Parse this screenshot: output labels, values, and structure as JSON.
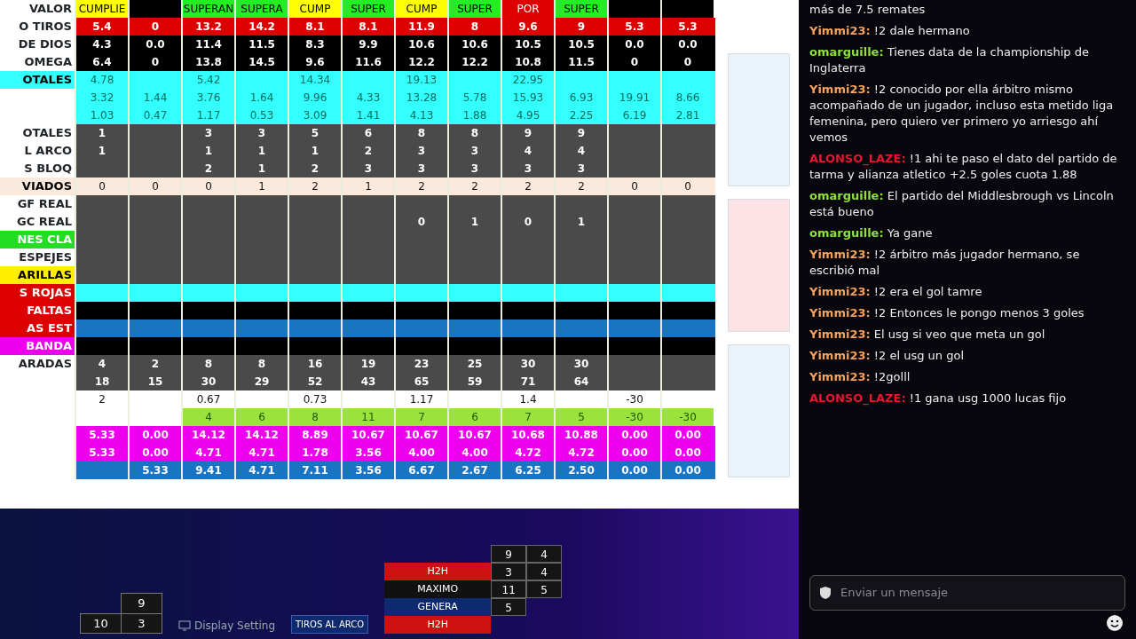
{
  "sheet": {
    "rows": [
      {
        "label": "VALOR",
        "kind": "header",
        "cells": [
          {
            "text": "CUMPLIE",
            "color": "#ffff00"
          },
          {
            "color": "#000000"
          },
          {
            "text": "SUPERAN",
            "color": "#22ee22"
          },
          {
            "text": "SUPERA",
            "color": "#22ee22"
          },
          {
            "text": "CUMP",
            "color": "#ffff00"
          },
          {
            "text": "SUPER",
            "color": "#22ee22"
          },
          {
            "text": "CUMP",
            "color": "#ffff00"
          },
          {
            "text": "SUPER",
            "color": "#22ee22"
          },
          {
            "text": "POR",
            "color": "#dd0000"
          },
          {
            "text": "SUPER",
            "color": "#22ee22"
          },
          {
            "color": "#000000"
          },
          {
            "color": "#000000"
          }
        ]
      },
      {
        "label": "O TIROS",
        "kind": "red",
        "cells": [
          "5.4",
          "0",
          "13.2",
          "14.2",
          "8.1",
          "8.1",
          "11.9",
          "8",
          "9.6",
          "9",
          "5.3",
          "5.3"
        ]
      },
      {
        "label": "DE DIOS",
        "kind": "black",
        "cells": [
          "4.3",
          "0.0",
          "11.4",
          "11.5",
          "8.3",
          "9.9",
          "10.6",
          "10.6",
          "10.5",
          "10.5",
          "0.0",
          "0.0"
        ]
      },
      {
        "label": "OMEGA",
        "kind": "black",
        "cells": [
          "6.4",
          "0",
          "13.8",
          "14.5",
          "9.6",
          "11.6",
          "12.2",
          "12.2",
          "10.8",
          "11.5",
          "0",
          "0"
        ]
      },
      {
        "label": "OTALES",
        "color": "#33ffff",
        "kind": "cyan",
        "cells": [
          "4.78",
          null,
          "5.42",
          null,
          "14.34",
          null,
          "19.13",
          null,
          "22.95",
          null,
          null,
          null
        ]
      },
      {
        "kind": "cyan",
        "cells": [
          "3.32",
          "1.44",
          "3.76",
          "1.64",
          "9.96",
          "4.33",
          "13.28",
          "5.78",
          "15.93",
          "6.93",
          "19.91",
          "8.66"
        ]
      },
      {
        "kind": "cyan",
        "cells": [
          "1.03",
          "0.47",
          "1.17",
          "0.53",
          "3.09",
          "1.41",
          "4.13",
          "1.88",
          "4.95",
          "2.25",
          "6.19",
          "2.81"
        ]
      },
      {
        "label": "OTALES",
        "kind": "gray",
        "cells": [
          "1",
          null,
          "3",
          "3",
          "5",
          "6",
          "8",
          "8",
          "9",
          "9",
          null,
          null
        ]
      },
      {
        "label": "L ARCO",
        "kind": "gray",
        "cells": [
          "1",
          null,
          "1",
          "1",
          "1",
          "2",
          "3",
          "3",
          "4",
          "4",
          null,
          null
        ]
      },
      {
        "label": "S BLOQ",
        "kind": "gray",
        "cells": [
          null,
          null,
          "2",
          "1",
          "2",
          "3",
          "3",
          "3",
          "3",
          "3",
          null,
          null
        ]
      },
      {
        "label": "VIADOS",
        "color": "#fbe9dc",
        "kind": "beige",
        "cells": [
          "0",
          "0",
          "0",
          "1",
          "2",
          "1",
          "2",
          "2",
          "2",
          "2",
          "0",
          "0"
        ]
      },
      {
        "label": "GF REAL",
        "kind": "gray",
        "cells": [
          null,
          null,
          null,
          null,
          null,
          null,
          null,
          null,
          null,
          null,
          null,
          null
        ]
      },
      {
        "label": "GC REAL",
        "kind": "gray",
        "cells": [
          null,
          null,
          null,
          null,
          null,
          null,
          "0",
          "1",
          "0",
          "1",
          null,
          null
        ]
      },
      {
        "label": "NES CLA",
        "color": "#22dd22",
        "kind": "gray",
        "cells": [
          null,
          null,
          null,
          null,
          null,
          null,
          null,
          null,
          null,
          null,
          null,
          null
        ]
      },
      {
        "label": "ESPEJES",
        "kind": "gray",
        "cells": [
          null,
          null,
          null,
          null,
          null,
          null,
          null,
          null,
          null,
          null,
          null,
          null
        ]
      },
      {
        "label": "ARILLAS",
        "color": "#ffee00",
        "kind": "gray",
        "cells": [
          null,
          null,
          null,
          null,
          null,
          null,
          null,
          null,
          null,
          null,
          null,
          null
        ]
      },
      {
        "label": "S ROJAS",
        "color": "#dd0000",
        "kind": "cyan",
        "cells": [
          null,
          null,
          null,
          null,
          null,
          null,
          null,
          null,
          null,
          null,
          null,
          null
        ]
      },
      {
        "label": "FALTAS",
        "color": "#dd0000",
        "kind": "black",
        "cells": [
          null,
          null,
          null,
          null,
          null,
          null,
          null,
          null,
          null,
          null,
          null,
          null
        ]
      },
      {
        "label": "AS EST",
        "color": "#dd0000",
        "kind": "blue",
        "cells": [
          null,
          null,
          null,
          null,
          null,
          null,
          null,
          null,
          null,
          null,
          null,
          null
        ]
      },
      {
        "label": "BANDA",
        "color": "#ee00ee",
        "kind": "black",
        "cells": [
          null,
          null,
          null,
          null,
          null,
          null,
          null,
          null,
          null,
          null,
          null,
          null
        ]
      },
      {
        "label": "ARADAS",
        "kind": "gray",
        "cells": [
          "4",
          "2",
          "8",
          "8",
          "16",
          "19",
          "23",
          "25",
          "30",
          "30",
          null,
          null
        ]
      },
      {
        "kind": "gray",
        "cells": [
          "18",
          "15",
          "30",
          "29",
          "52",
          "43",
          "65",
          "59",
          "71",
          "64",
          null,
          null
        ]
      },
      {
        "kind": "white",
        "cells": [
          "2",
          null,
          "0.67",
          null,
          "0.73",
          null,
          "1.17",
          null,
          "1.4",
          null,
          "-30",
          null
        ]
      },
      {
        "kind": "green",
        "cells": [
          null,
          null,
          "4",
          "6",
          "8",
          "11",
          "7",
          "6",
          "7",
          "5",
          "-30",
          "-30"
        ]
      },
      {
        "kind": "magenta",
        "cells": [
          "5.33",
          "0.00",
          "14.12",
          "14.12",
          "8.89",
          "10.67",
          "10.67",
          "10.67",
          "10.68",
          "10.88",
          "0.00",
          "0.00"
        ]
      },
      {
        "kind": "magenta",
        "cells": [
          "5.33",
          "0.00",
          "4.71",
          "4.71",
          "1.78",
          "3.56",
          "4.00",
          "4.00",
          "4.72",
          "4.72",
          "0.00",
          "0.00"
        ]
      },
      {
        "kind": "blue",
        "cells": [
          null,
          "5.33",
          "9.41",
          "4.71",
          "7.11",
          "3.56",
          "6.67",
          "2.67",
          "6.25",
          "2.50",
          "0.00",
          "0.00"
        ]
      }
    ]
  },
  "bottom": {
    "left_table": [
      [
        "9"
      ],
      [
        "10",
        "3"
      ]
    ],
    "display_label": "Display Setting",
    "side_label": "TIROS AL ARCO",
    "right_table": [
      {
        "values": [
          "9",
          "4"
        ]
      },
      {
        "label": "H2H",
        "color": "#cc1111",
        "values": [
          "3",
          "4"
        ]
      },
      {
        "label": "MAXIMO",
        "color": "#111111",
        "values": [
          "11",
          "5"
        ]
      },
      {
        "label": "GENERA",
        "color": "#0d2a6e",
        "values": [
          "5"
        ]
      },
      {
        "label": "H2H",
        "color": "#cc1111"
      }
    ]
  },
  "chat": {
    "messages": [
      {
        "text": "más de 7.5 remates"
      },
      {
        "user": "Yimmi23:",
        "color": "#f5a35c",
        "text": "!2 dale hermano"
      },
      {
        "user": "omarguille:",
        "color": "#8ee03a",
        "text": "Tienes data de la championship de Inglaterra"
      },
      {
        "user": "Yimmi23:",
        "color": "#f5a35c",
        "text": "!2 conocido por ella árbitro mismo acompañado de un jugador, incluso esta metido liga femenina, pero quiero ver primero yo arriesgo ahí vemos"
      },
      {
        "user": "ALONSO_LAZE:",
        "color": "#e8162e",
        "text": "!1 ahi te paso el dato del partido de tarma y alianza atletico +2.5 goles cuota 1.88"
      },
      {
        "user": "omarguille:",
        "color": "#8ee03a",
        "text": "El partido del Middlesbrough vs Lincoln está bueno"
      },
      {
        "user": "omarguille:",
        "color": "#8ee03a",
        "text": "Ya gane"
      },
      {
        "user": "Yimmi23:",
        "color": "#f5a35c",
        "text": "!2 árbitro más jugador hermano, se escribió mal"
      },
      {
        "user": "Yimmi23:",
        "color": "#f5a35c",
        "text": "!2 era el gol tamre"
      },
      {
        "user": "Yimmi23:",
        "color": "#f5a35c",
        "text": "!2 Entonces le pongo menos 3 goles"
      },
      {
        "user": "Yimmi23:",
        "color": "#f5a35c",
        "text": "El usg si veo que meta un gol"
      },
      {
        "user": "Yimmi23:",
        "color": "#f5a35c",
        "text": "!2 el usg un gol"
      },
      {
        "user": "Yimmi23:",
        "color": "#f5a35c",
        "text": "!2golll"
      },
      {
        "user": "ALONSO_LAZE:",
        "color": "#e8162e",
        "text": "!1 gana usg 1000 lucas fijo"
      }
    ],
    "input": {
      "placeholder": "Enviar un mensaje"
    }
  }
}
